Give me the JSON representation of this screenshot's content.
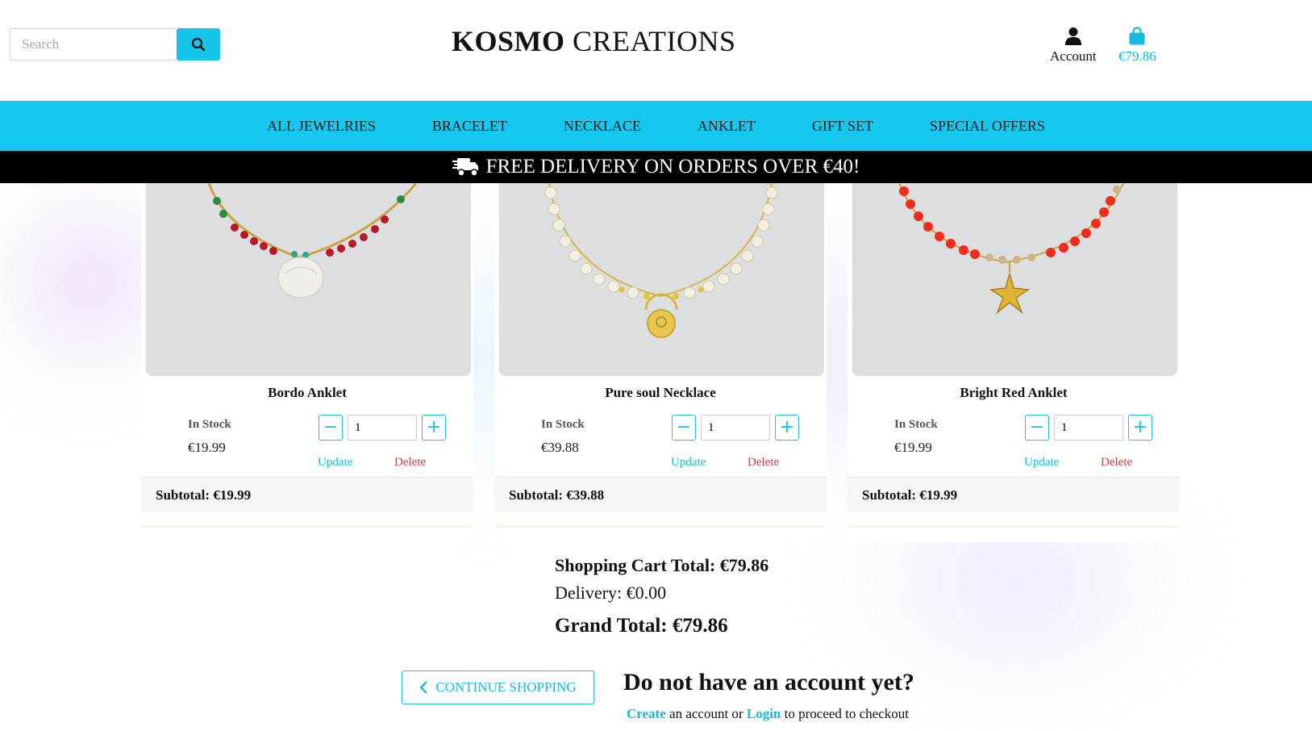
{
  "header": {
    "search_placeholder": "Search",
    "brand_bold": "KOSMO",
    "brand_rest": " CREATIONS",
    "account_label": "Account",
    "cart_total": "€79.86"
  },
  "nav": {
    "items": [
      "ALL JEWELRIES",
      "BRACELET",
      "NECKLACE",
      "ANKLET",
      "GIFT SET",
      "SPECIAL OFFERS"
    ]
  },
  "banner": {
    "text": "FREE DELIVERY ON ORDERS OVER €40!"
  },
  "products": [
    {
      "name": "Bordo Anklet",
      "stock": "In Stock",
      "price": "€19.99",
      "quantity": "1",
      "update_label": "Update",
      "delete_label": "Delete",
      "subtotal": "Subtotal: €19.99"
    },
    {
      "name": "Pure soul Necklace",
      "stock": "In Stock",
      "price": "€39.88",
      "quantity": "1",
      "update_label": "Update",
      "delete_label": "Delete",
      "subtotal": "Subtotal: €39.88"
    },
    {
      "name": "Bright Red Anklet",
      "stock": "In Stock",
      "price": "€19.99",
      "quantity": "1",
      "update_label": "Update",
      "delete_label": "Delete",
      "subtotal": "Subtotal: €19.99"
    }
  ],
  "totals": {
    "cart_total": "Shopping Cart Total: €79.86",
    "delivery": "Delivery: €0.00",
    "grand_total": "Grand Total: €79.86"
  },
  "footer": {
    "continue_label": "CONTINUE SHOPPING",
    "no_account": "Do not have an account yet?",
    "create_link": "Create",
    "middle_text": " an account or ",
    "login_link": "Login",
    "end_text": " to proceed to checkout"
  },
  "colors": {
    "accent": "#16c7ee",
    "delete": "#d43b3b",
    "banner_bg": "#000000"
  }
}
